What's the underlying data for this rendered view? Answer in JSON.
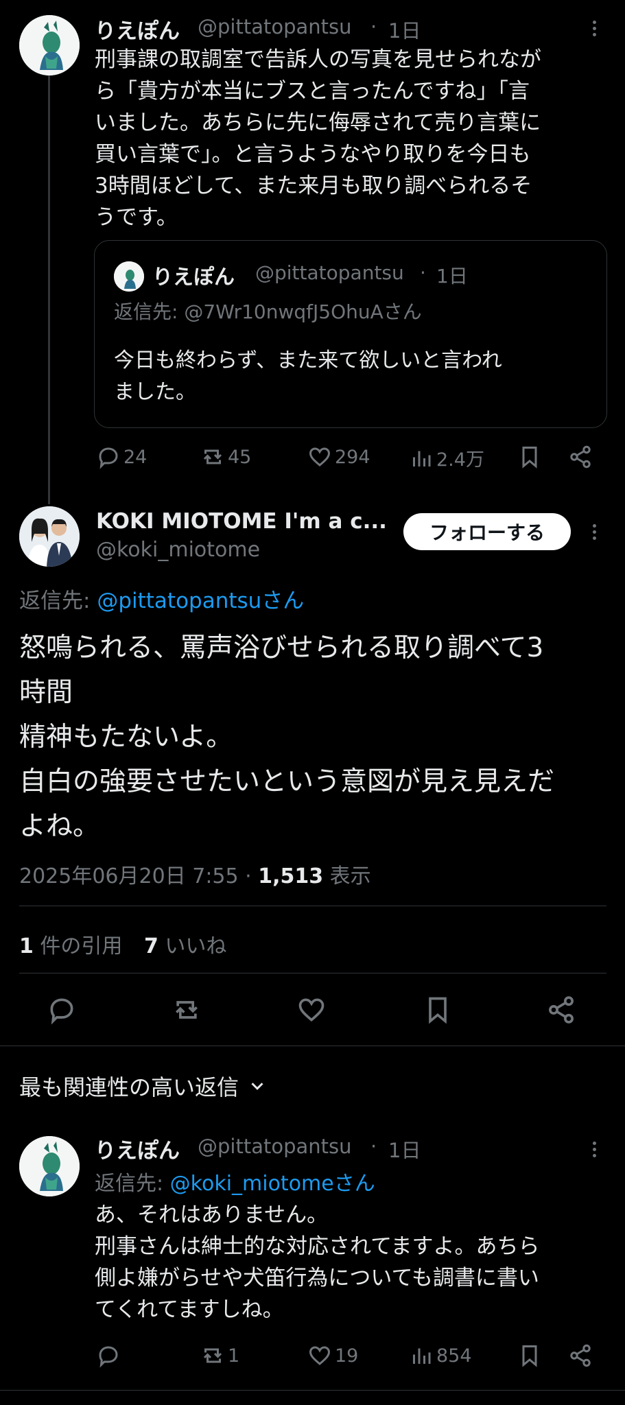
{
  "tweet1": {
    "name": "りえぽん",
    "handle": "@pittatopantsu",
    "time": "1日",
    "lines": [
      "刑事課の取調室で告訴人の写真を見せられなが",
      "ら「貴方が本当にブスと言ったんですね」「言",
      "いました。あちらに先に侮辱されて売り言葉に",
      "買い言葉で」。と言うようなやり取りを今日も",
      "3時間ほどして、また来月も取り調べられるそ",
      "うです。"
    ],
    "quote": {
      "name": "りえぽん",
      "handle": "@pittatopantsu",
      "time": "1日",
      "reply_to": "返信先: @7Wr10nwqfJ5OhuAさん",
      "lines": [
        "今日も終わらず、また来て欲しいと言われ",
        "ました。"
      ]
    },
    "stats": {
      "replies": "24",
      "reposts": "45",
      "likes": "294",
      "views": "2.4万"
    }
  },
  "main": {
    "name": "KOKI MIOTOME I'm a c...",
    "handle": "@koki_miotome",
    "follow_label": "フォローする",
    "reply_prefix": "返信先: ",
    "reply_to": "@pittatopantsuさん",
    "lines": [
      "怒鳴られる、罵声浴びせられる取り調べて3",
      "時間",
      "精神もたないよ。",
      "自白の強要させたいという意図が見え見えだ",
      "よね。"
    ],
    "timestamp": "2025年06月20日 7:55",
    "views_count": "1,513",
    "views_label": "表示",
    "quotes_count": "1",
    "quotes_label": "件の引用",
    "likes_count": "7",
    "likes_label": "いいね"
  },
  "sort": {
    "label": "最も関連性の高い返信"
  },
  "reply1": {
    "name": "りえぽん",
    "handle": "@pittatopantsu",
    "time": "1日",
    "reply_prefix": "返信先: ",
    "reply_to": "@koki_miotomeさん",
    "lines": [
      "あ、それはありません。",
      "刑事さんは紳士的な対応されてますよ。あちら",
      "側よ嫌がらせや犬笛行為についても調書に書い",
      "てくれてますしね。"
    ],
    "stats": {
      "reposts": "1",
      "likes": "19",
      "views": "854"
    }
  },
  "colors": {
    "accent": "#1d9bf0",
    "muted": "#71767b",
    "background": "#000000",
    "text": "#e7e9ea"
  }
}
